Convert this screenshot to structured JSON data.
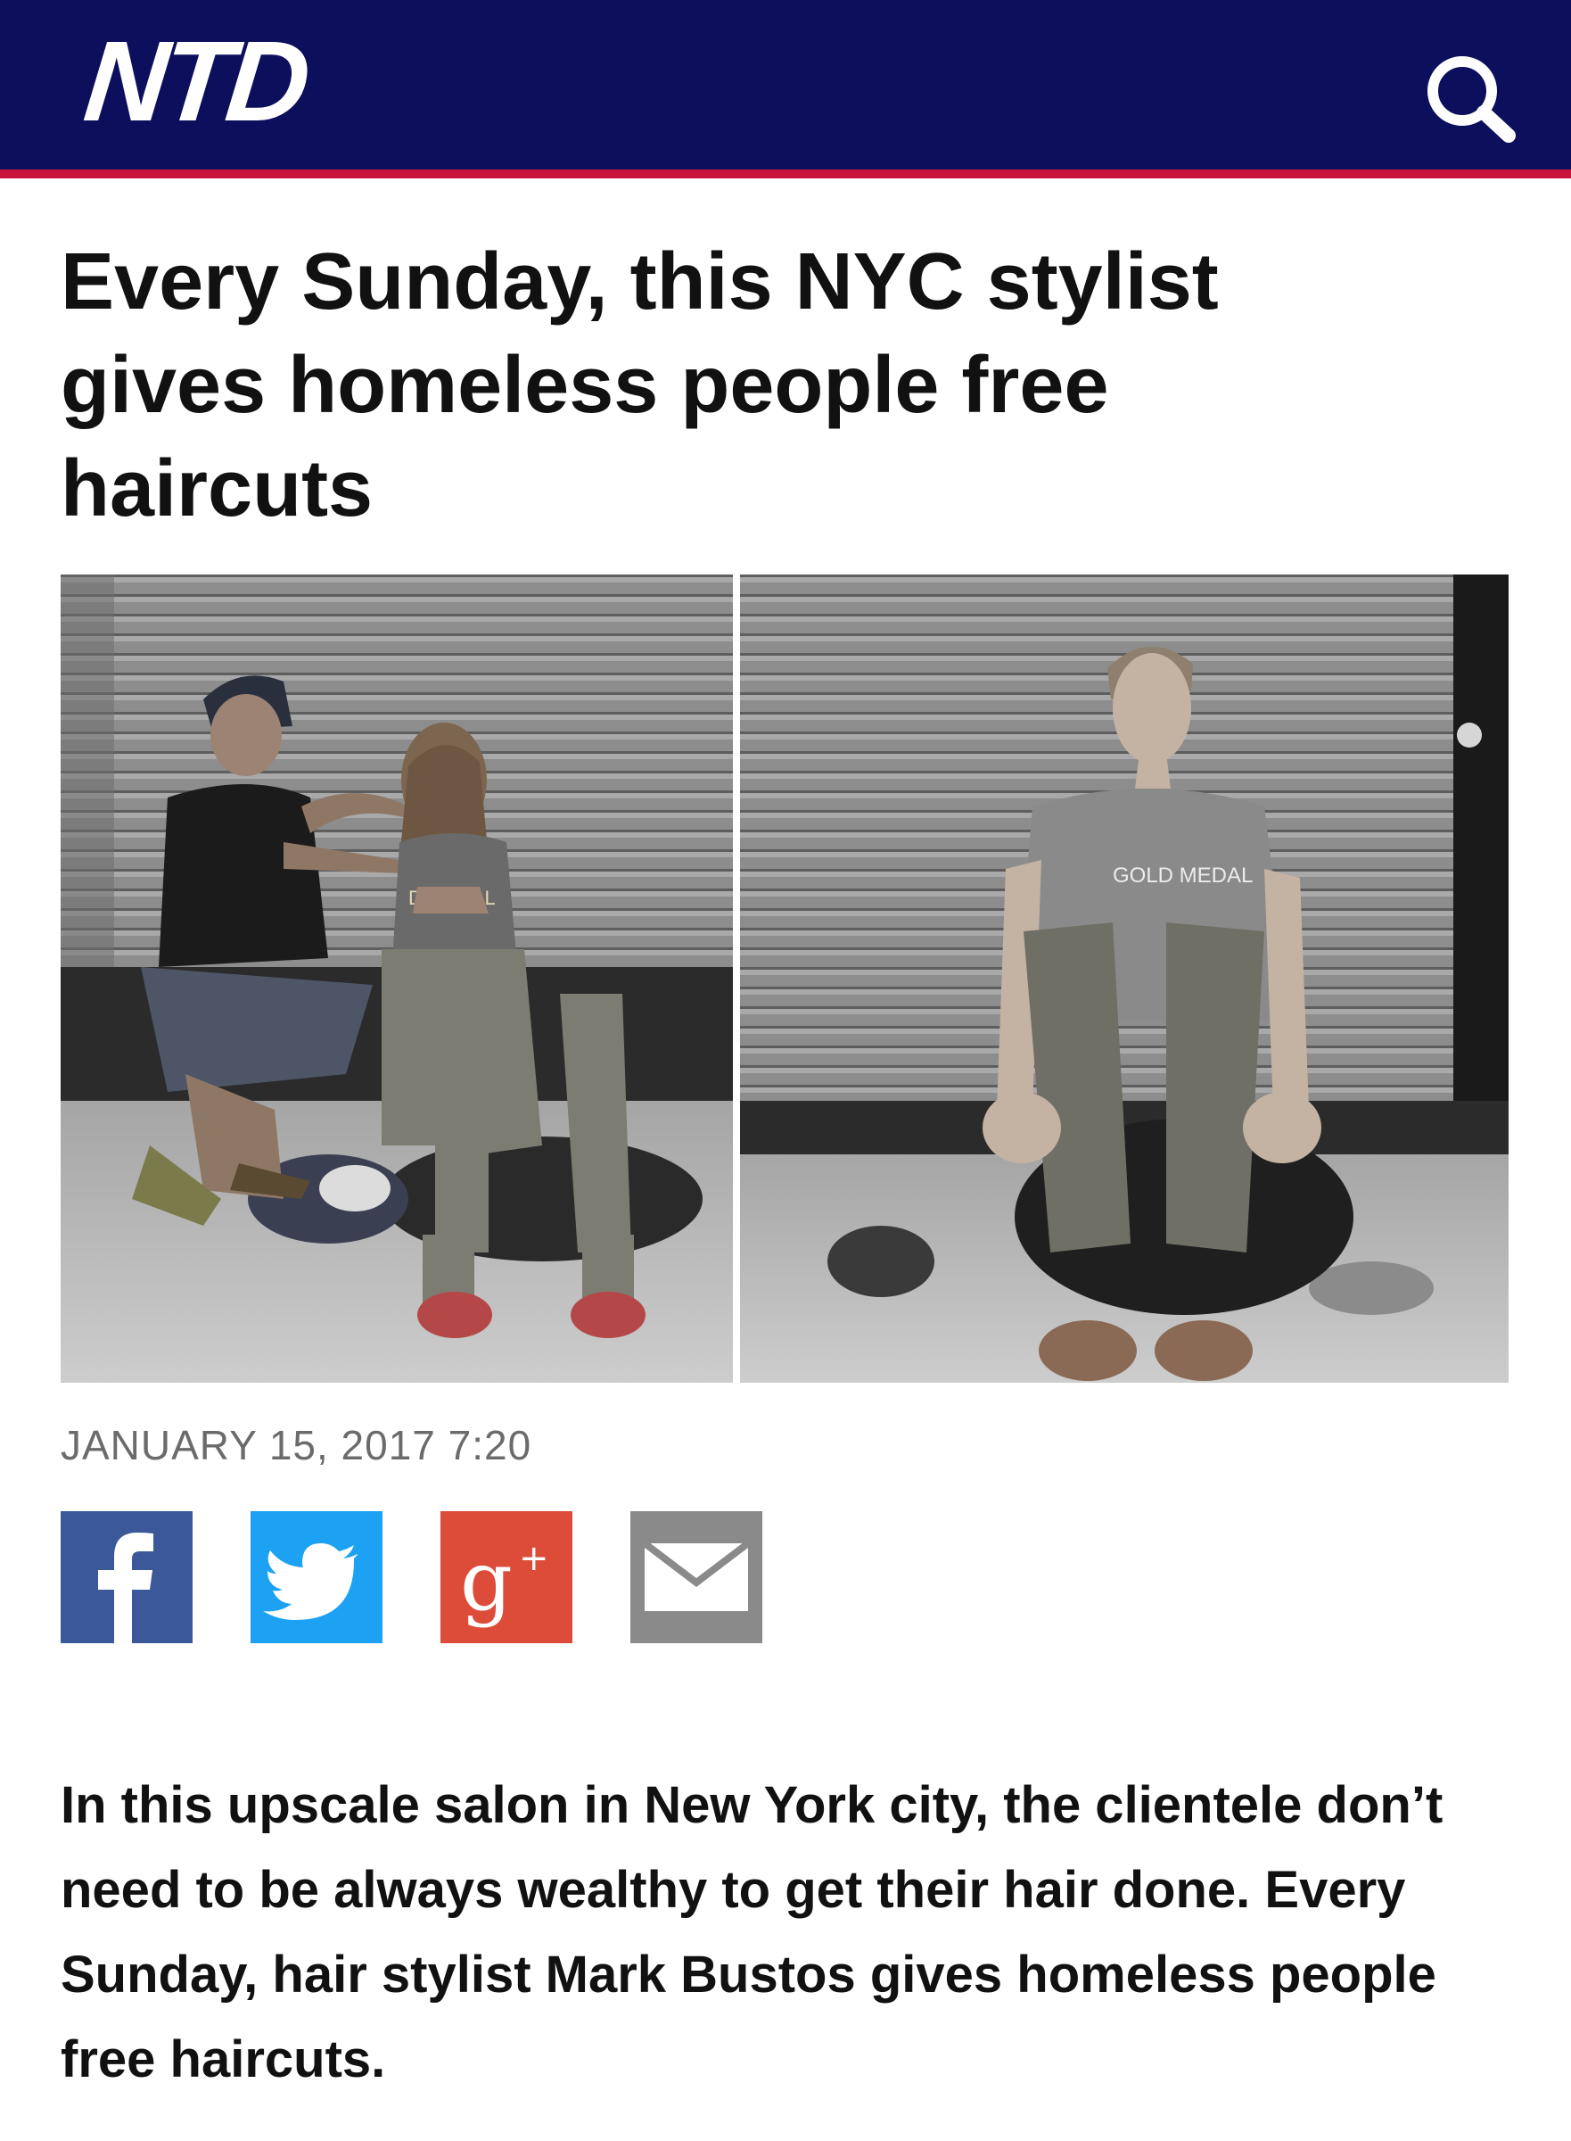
{
  "header": {
    "logo_text": "NTD",
    "search_icon": "search-icon",
    "colors": {
      "background": "#0c0f5c",
      "accent_stripe": "#c8123b"
    }
  },
  "article": {
    "title": "Every Sunday, this NYC stylist gives homeless people free haircuts",
    "published": "JANUARY 15, 2017 7:20",
    "lead": "In this upscale salon in New York city, the clientele don’t need to be always wealthy to get their hair done. Every Sunday, hair stylist Mark Bustos gives homeless people free haircuts.",
    "photo": {
      "left_shirt_text": "D MEDAL",
      "right_shirt_text": "GOLD MEDAL"
    }
  },
  "share": [
    {
      "name": "facebook",
      "icon": "facebook-icon",
      "color": "#3b5998"
    },
    {
      "name": "twitter",
      "icon": "twitter-icon",
      "color": "#1da1f2"
    },
    {
      "name": "google-plus",
      "icon": "google-plus-icon",
      "color": "#dd4b39"
    },
    {
      "name": "email",
      "icon": "envelope-icon",
      "color": "#8a8a8a"
    }
  ]
}
